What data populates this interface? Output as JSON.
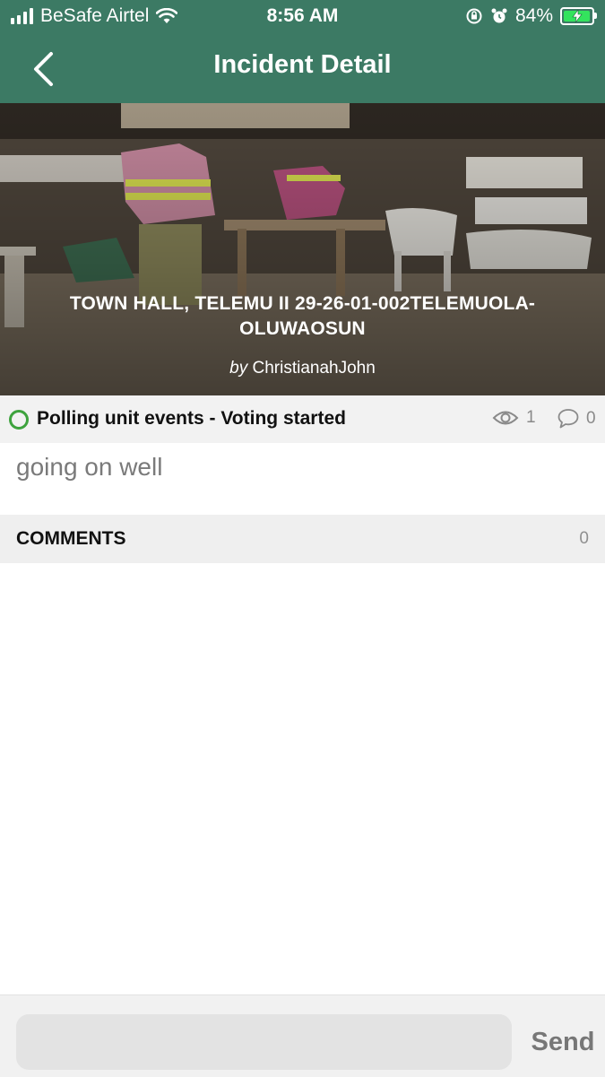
{
  "status_bar": {
    "carrier": "BeSafe Airtel",
    "time": "8:56 AM",
    "battery_percent": "84%",
    "battery_level": 0.84,
    "icons": [
      "signal-bars-icon",
      "wifi-icon",
      "rotation-lock-icon",
      "alarm-icon",
      "battery-charging-icon"
    ]
  },
  "nav": {
    "title": "Incident Detail",
    "back_icon": "chevron-left-icon"
  },
  "incident": {
    "location": "TOWN HALL, TELEMU II 29-26-01-002TELEMUOLA-OLUWAOSUN",
    "by_prefix": "by",
    "author": "ChristianahJohn",
    "category": "Polling unit events - Voting started",
    "category_color": "#3ea33e",
    "views": "1",
    "comments_count": "0",
    "description": "going on well"
  },
  "comments": {
    "title": "COMMENTS",
    "count": "0"
  },
  "composer": {
    "placeholder": "",
    "send_label": "Send"
  },
  "colors": {
    "header": "#3c7a64",
    "accent_green": "#3ea33e"
  }
}
